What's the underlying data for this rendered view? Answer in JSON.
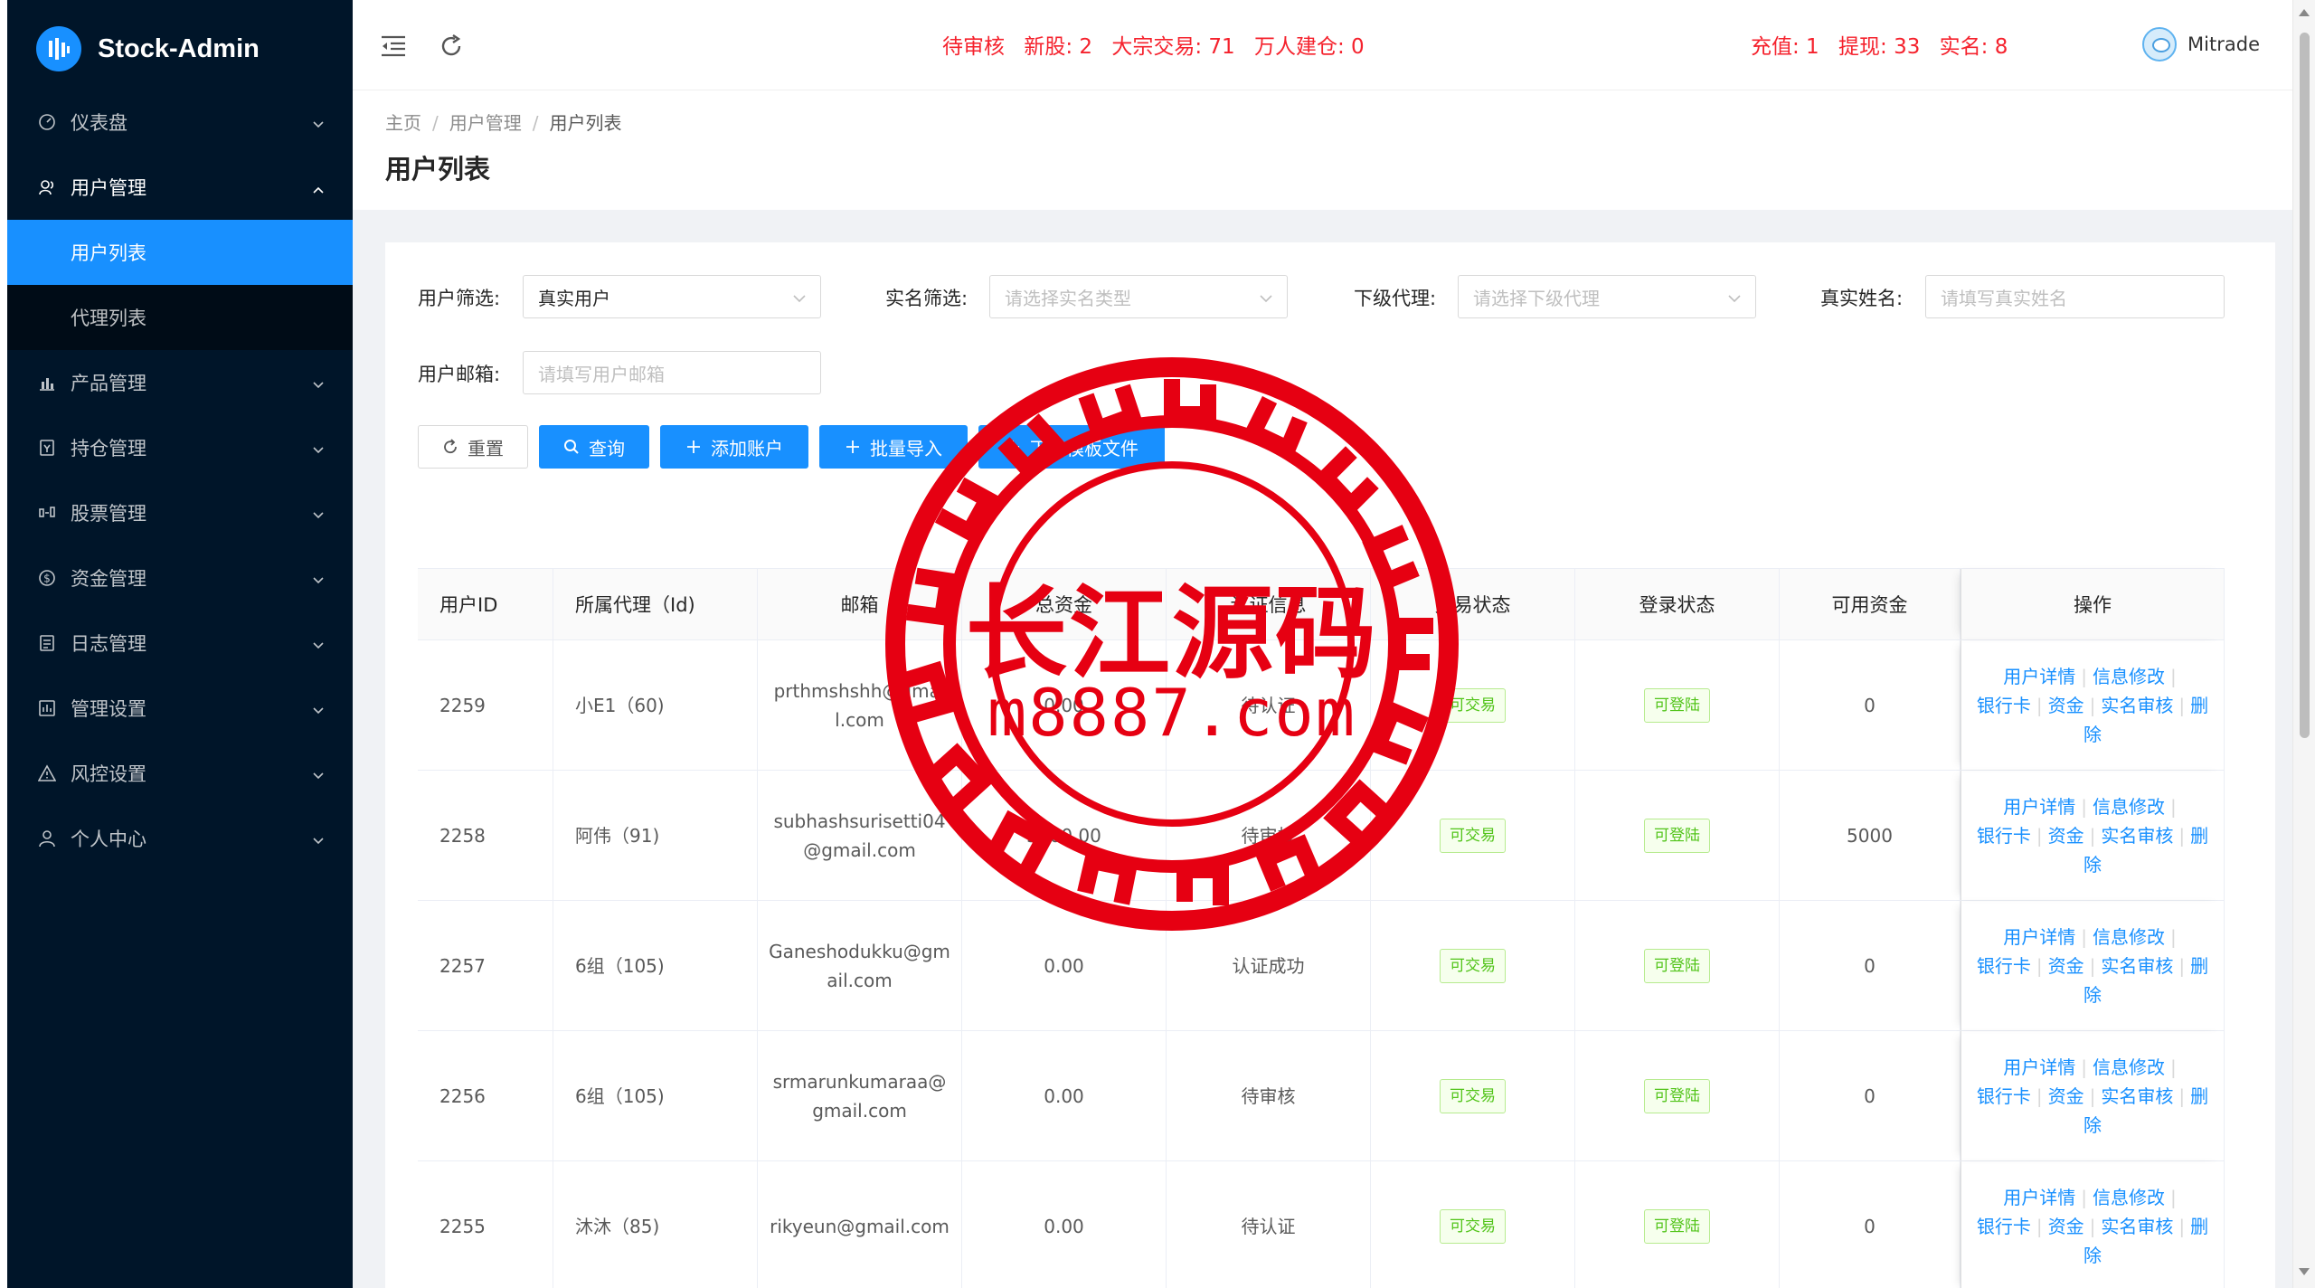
{
  "app": {
    "title": "Stock-Admin"
  },
  "sidebar": {
    "items": [
      {
        "label": "仪表盘",
        "icon": "dashboard-icon"
      },
      {
        "label": "用户管理",
        "icon": "users-icon",
        "open": true,
        "children": [
          {
            "label": "用户列表",
            "active": true
          },
          {
            "label": "代理列表"
          }
        ]
      },
      {
        "label": "产品管理",
        "icon": "chart-icon"
      },
      {
        "label": "持仓管理",
        "icon": "position-icon"
      },
      {
        "label": "股票管理",
        "icon": "stock-icon"
      },
      {
        "label": "资金管理",
        "icon": "money-icon"
      },
      {
        "label": "日志管理",
        "icon": "log-icon"
      },
      {
        "label": "管理设置",
        "icon": "settings-icon"
      },
      {
        "label": "风控设置",
        "icon": "warning-icon"
      },
      {
        "label": "个人中心",
        "icon": "user-icon"
      }
    ]
  },
  "header": {
    "notice_left": [
      "待审核",
      "新股: 2",
      "大宗交易: 71",
      "万人建仓: 0"
    ],
    "notice_right": [
      "充值: 1",
      "提现: 33",
      "实名: 8"
    ],
    "username": "Mitrade",
    "notice_color": "#f5222d"
  },
  "breadcrumb": [
    "主页",
    "用户管理",
    "用户列表"
  ],
  "page_title": "用户列表",
  "filters": {
    "user_filter": {
      "label": "用户筛选:",
      "value": "真实用户"
    },
    "realname_filter": {
      "label": "实名筛选:",
      "placeholder": "请选择实名类型"
    },
    "agent_filter": {
      "label": "下级代理:",
      "placeholder": "请选择下级代理"
    },
    "realname_input": {
      "label": "真实姓名:",
      "placeholder": "请填写真实姓名"
    },
    "email_input": {
      "label": "用户邮箱:",
      "placeholder": "请填写用户邮箱"
    }
  },
  "buttons": {
    "reset": "重置",
    "query": "查询",
    "add_account": "添加账户",
    "batch_import": "批量导入",
    "download_template": "下载模板文件"
  },
  "table": {
    "columns": [
      "用户ID",
      "所属代理（Id)",
      "邮箱",
      "总资金",
      "认证信息",
      "交易状态",
      "登录状态",
      "可用资金",
      "操作"
    ],
    "actions": [
      "用户详情",
      "信息修改",
      "银行卡",
      "资金",
      "实名审核",
      "删除"
    ],
    "rows": [
      {
        "id": "2259",
        "agent": "小E1（60)",
        "email": "prthmshshh@gmail.com",
        "total": "0.00",
        "auth": "待认证",
        "trade": "可交易",
        "login": "可登陆",
        "available": "0"
      },
      {
        "id": "2258",
        "agent": "阿伟（91)",
        "email": "subhashsurisetti04@gmail.com",
        "total": "5000.00",
        "auth": "待审核",
        "trade": "可交易",
        "login": "可登陆",
        "available": "5000"
      },
      {
        "id": "2257",
        "agent": "6组（105)",
        "email": "Ganeshodukku@gmail.com",
        "total": "0.00",
        "auth": "认证成功",
        "trade": "可交易",
        "login": "可登陆",
        "available": "0"
      },
      {
        "id": "2256",
        "agent": "6组（105)",
        "email": "srmarunkumaraa@gmail.com",
        "total": "0.00",
        "auth": "待审核",
        "trade": "可交易",
        "login": "可登陆",
        "available": "0"
      },
      {
        "id": "2255",
        "agent": "沐沐（85)",
        "email": "rikyeun@gmail.com",
        "total": "0.00",
        "auth": "待认证",
        "trade": "可交易",
        "login": "可登陆",
        "available": "0"
      }
    ]
  },
  "watermark": {
    "title": "长江源码",
    "url": "m8887.com",
    "color": "#e60012"
  },
  "colors": {
    "sidebar_bg": "#001529",
    "primary": "#1890ff",
    "tag_green": "#52c41a"
  }
}
